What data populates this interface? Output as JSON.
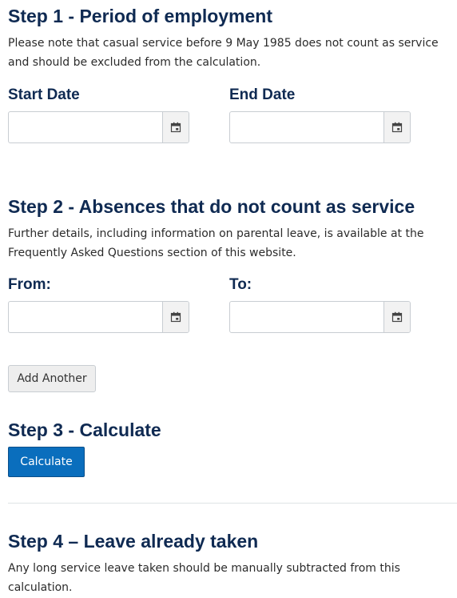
{
  "step1": {
    "heading": "Step 1 - Period of employment",
    "note": "Please note that casual service before 9 May 1985 does not count as service and should be excluded from the calculation.",
    "start_label": "Start Date",
    "start_value": "",
    "end_label": "End Date",
    "end_value": ""
  },
  "step2": {
    "heading": "Step 2 - Absences that do not count as service",
    "note": "Further details, including information on parental leave, is available at the Frequently Asked Questions section of this website.",
    "from_label": "From:",
    "from_value": "",
    "to_label": "To:",
    "to_value": "",
    "add_button": "Add Another"
  },
  "step3": {
    "heading": "Step 3 - Calculate",
    "button": "Calculate"
  },
  "step4": {
    "heading": "Step 4 – Leave already taken",
    "note": "Any long service leave taken should be manually subtracted from this calculation."
  },
  "icons": {
    "calendar": "calendar-icon"
  },
  "colors": {
    "heading": "#0f2a52",
    "primary_button": "#0a6ebd"
  }
}
